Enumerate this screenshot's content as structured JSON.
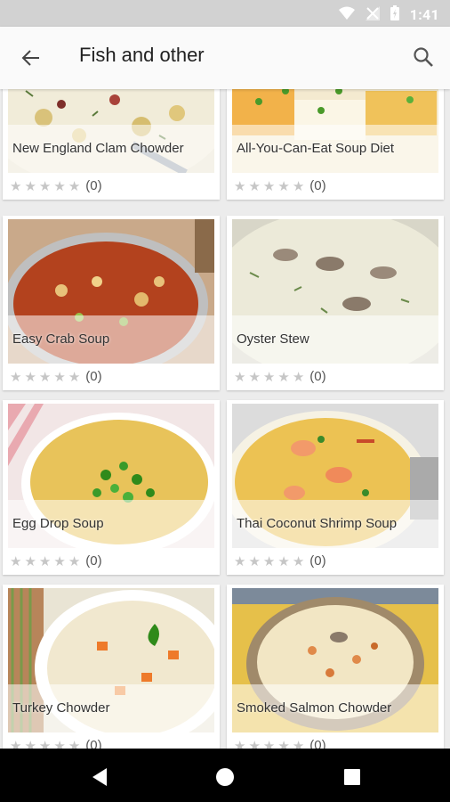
{
  "status_bar": {
    "time": "1:41"
  },
  "app_bar": {
    "title": "Fish and other"
  },
  "recipes": [
    {
      "name": "New England Clam Chowder",
      "rating": "(0)"
    },
    {
      "name": "All-You-Can-Eat Soup Diet",
      "rating": "(0)"
    },
    {
      "name": "Easy Crab Soup",
      "rating": "(0)"
    },
    {
      "name": "Oyster Stew",
      "rating": "(0)"
    },
    {
      "name": "Egg Drop Soup",
      "rating": "(0)"
    },
    {
      "name": "Thai Coconut Shrimp Soup",
      "rating": "(0)"
    },
    {
      "name": "Turkey Chowder",
      "rating": "(0)"
    },
    {
      "name": "Smoked Salmon Chowder",
      "rating": "(0)"
    }
  ]
}
